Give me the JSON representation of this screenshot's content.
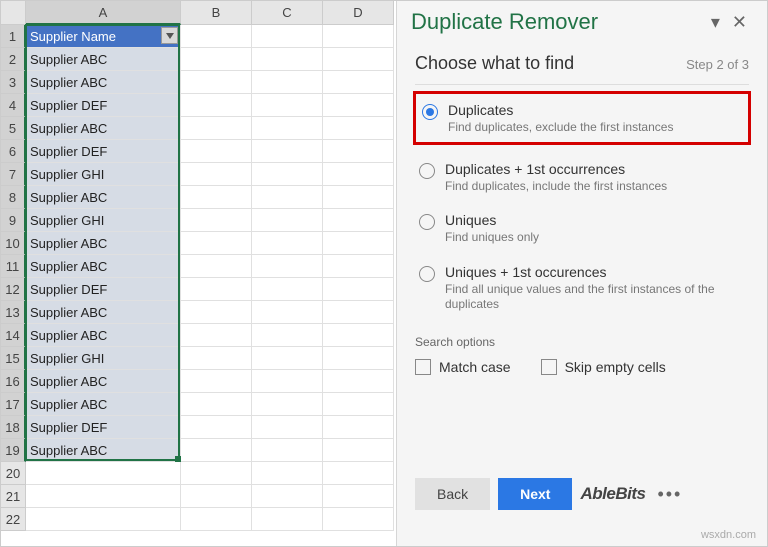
{
  "grid": {
    "columns": [
      "A",
      "B",
      "C",
      "D"
    ],
    "header_cell": "Supplier Name",
    "rows": [
      "Supplier ABC",
      "Supplier ABC",
      "Supplier DEF",
      "Supplier ABC",
      "Supplier DEF",
      "Supplier GHI",
      "Supplier ABC",
      "Supplier GHI",
      "Supplier ABC",
      "Supplier ABC",
      "Supplier DEF",
      "Supplier ABC",
      "Supplier ABC",
      "Supplier GHI",
      "Supplier ABC",
      "Supplier ABC",
      "Supplier DEF",
      "Supplier ABC"
    ],
    "empty_rows": [
      "20",
      "21",
      "22"
    ]
  },
  "pane": {
    "title": "Duplicate Remover",
    "step_title": "Choose what to find",
    "step_count": "Step 2 of 3",
    "options": [
      {
        "label": "Duplicates",
        "desc": "Find duplicates, exclude the first instances",
        "checked": true,
        "highlight": true
      },
      {
        "label": "Duplicates + 1st occurrences",
        "desc": "Find duplicates, include the first instances",
        "checked": false,
        "highlight": false
      },
      {
        "label": "Uniques",
        "desc": "Find uniques only",
        "checked": false,
        "highlight": false
      },
      {
        "label": "Uniques + 1st occurences",
        "desc": "Find all unique values and the first instances of the duplicates",
        "checked": false,
        "highlight": false
      }
    ],
    "search_options_label": "Search options",
    "match_case": "Match case",
    "skip_empty": "Skip empty cells",
    "back": "Back",
    "next": "Next",
    "brand": "AbleBits"
  },
  "watermark": "wsxdn.com"
}
